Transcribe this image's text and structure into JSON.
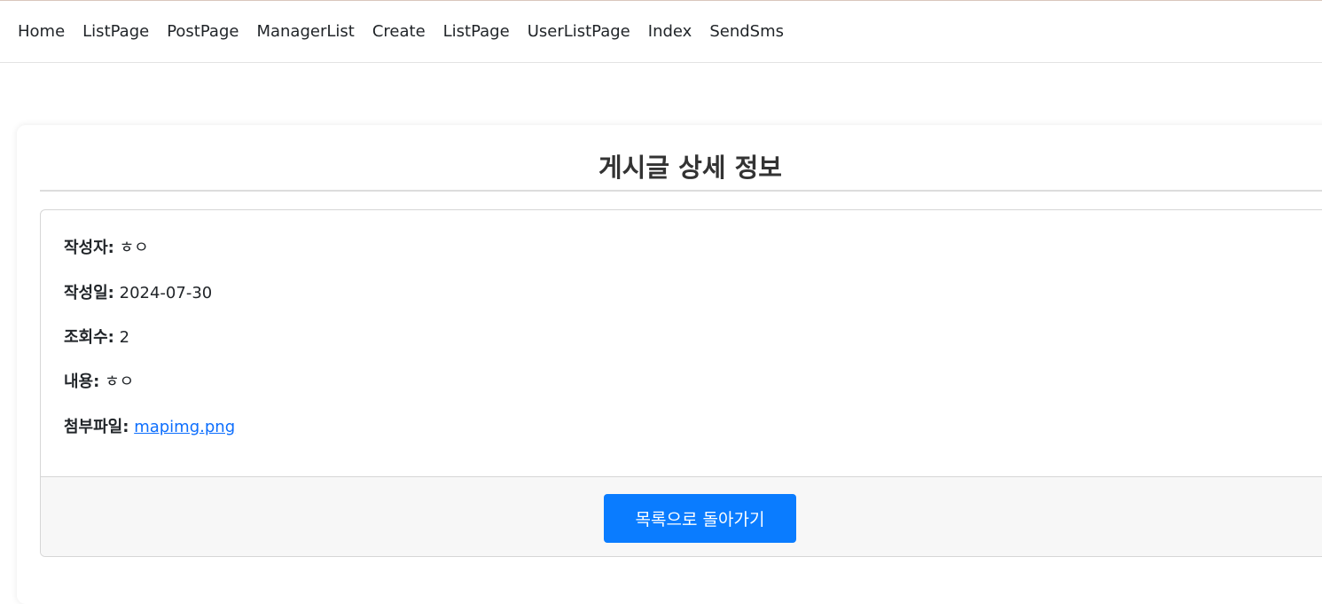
{
  "nav": {
    "items": [
      "Home",
      "ListPage",
      "PostPage",
      "ManagerList",
      "Create",
      "ListPage",
      "UserListPage",
      "Index",
      "SendSms"
    ]
  },
  "page": {
    "title": "게시글 상세 정보"
  },
  "detail": {
    "author_label": "작성자:",
    "author_value": "ㅎㅇ",
    "date_label": "작성일:",
    "date_value": "2024-07-30",
    "views_label": "조회수:",
    "views_value": "2",
    "content_label": "내용:",
    "content_value": "ㅎㅇ",
    "attachment_label": "첨부파일:",
    "attachment_value": "mapimg.png"
  },
  "footer": {
    "back_label": "목록으로 돌아가기"
  },
  "colors": {
    "accent": "#0a7cff",
    "link": "#0d6efd"
  }
}
